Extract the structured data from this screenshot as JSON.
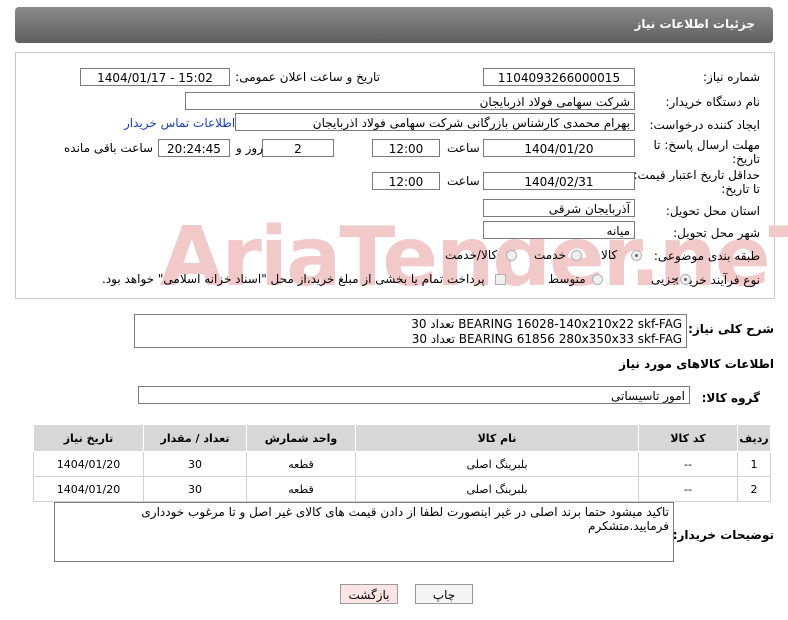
{
  "header": {
    "title": "جزئیات اطلاعات نیاز"
  },
  "form": {
    "need_number_label": "شماره نیاز:",
    "need_number": "1104093266000015",
    "announce_label": "تاریخ و ساعت اعلان عمومی:",
    "announce_value": "1404/01/17 - 15:02",
    "buyer_org_label": "نام دستگاه خریدار:",
    "buyer_org": "شرکت سهامی فولاد اذربایجان",
    "creator_label": "ایجاد کننده درخواست:",
    "creator": "بهرام محمدی کارشناس بازرگانی شرکت سهامی فولاد اذربایجان",
    "buyer_contact_link": "اطلاعات تماس خریدار",
    "deadline_label_line1": "مهلت ارسال پاسخ: تا",
    "deadline_label_line2": "تاریخ:",
    "deadline_date": "1404/01/20",
    "time_label": "ساعت",
    "deadline_time": "12:00",
    "days_value": "2",
    "days_label": "روز و",
    "remaining_time": "20:24:45",
    "remaining_label": "ساعت باقی مانده",
    "validity_label_line1": "حداقل تاریخ اعتبار قیمت:",
    "validity_label_line2": "تا تاریخ:",
    "validity_date": "1404/02/31",
    "validity_time": "12:00",
    "province_label": "استان محل تحویل:",
    "province": "آذربایجان شرقی",
    "city_label": "شهر محل تحویل:",
    "city": "میانه",
    "category_label": "طبقه بندی موضوعی:",
    "category_options": [
      "کالا",
      "خدمت",
      "کالا/خدمت"
    ],
    "process_label": "نوع فرآیند خرید :",
    "process_options": [
      "جزیی",
      "متوسط"
    ],
    "payment_note": "پرداخت تمام یا بخشی از مبلغ خرید،از محل \"اسناد خزانه اسلامی\" خواهد بود."
  },
  "watermark": "AriaTender.neT",
  "description": {
    "label": "شرح کلی نیاز:",
    "line1": "BEARING 16028-140x210x22 skf-FAG تعداد 30",
    "line2": "BEARING 61856 280x350x33 skf-FAG تعداد 30"
  },
  "goods_info": {
    "title": "اطلاعات کالاهای مورد نیاز",
    "group_label": "گروه کالا:",
    "group_value": "امور تاسیساتی"
  },
  "items_table": {
    "headers": [
      "ردیف",
      "کد کالا",
      "نام کالا",
      "واحد شمارش",
      "تعداد / مقدار",
      "تاریخ نیاز"
    ],
    "rows": [
      [
        "1",
        "--",
        "بلبرینگ اصلی",
        "قطعه",
        "30",
        "1404/01/20"
      ],
      [
        "2",
        "--",
        "بلبرینگ اصلی",
        "قطعه",
        "30",
        "1404/01/20"
      ]
    ]
  },
  "notes": {
    "label": "توضیحات خریدار:",
    "text": "تاکید میشود حتما برند اصلی در غیر اینصورت لطفا از دادن قیمت های کالای غیر اصل و تا مرغوب خودداری فرمایید.متشکرم"
  },
  "buttons": {
    "print": "چاپ",
    "back": "بازگشت"
  }
}
